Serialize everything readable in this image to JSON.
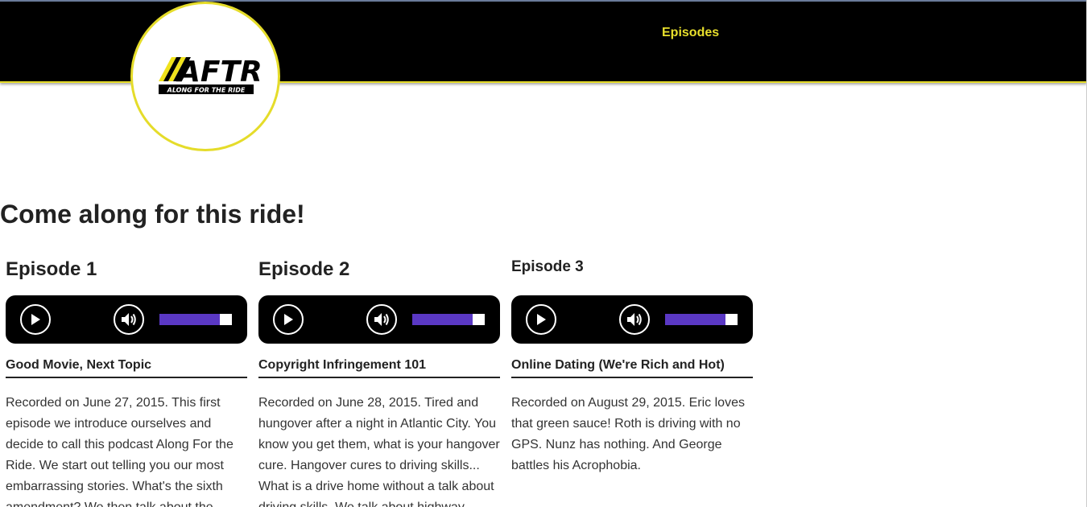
{
  "nav": {
    "episodes_label": "Episodes"
  },
  "logo": {
    "main_text": "AFTR",
    "tagline": "ALONG FOR THE RIDE"
  },
  "page": {
    "title": "Come along for this ride!"
  },
  "colors": {
    "accent_yellow": "#e8df2c",
    "volume_purple": "#5a38c4",
    "header_bg": "#000000"
  },
  "episodes": [
    {
      "heading": "Episode 1",
      "title": "Good Movie, Next Topic",
      "volume": 0.83,
      "description": "Recorded on June 27, 2015. This first episode we introduce ourselves and decide to call this podcast Along For the Ride. We start out telling you our most embarrassing stories. What's the sixth amendment? We then talk about the"
    },
    {
      "heading": "Episode 2",
      "title": "Copyright Infringement 101",
      "volume": 0.83,
      "description": "Recorded on June 28, 2015. Tired and hungover after a night in Atlantic City. You know you get them, what is your hangover cure. Hangover cures to driving skills... What is a drive home without a talk about driving skills. We talk about highway"
    },
    {
      "heading": "Episode 3",
      "title": "Online Dating (We're Rich and Hot)",
      "volume": 0.83,
      "description": "Recorded on August 29, 2015. Eric loves that green sauce! Roth is driving with no GPS. Nunz has nothing. And George battles his Acrophobia."
    }
  ],
  "icons": {
    "play": "play-icon",
    "volume": "volume-icon"
  }
}
